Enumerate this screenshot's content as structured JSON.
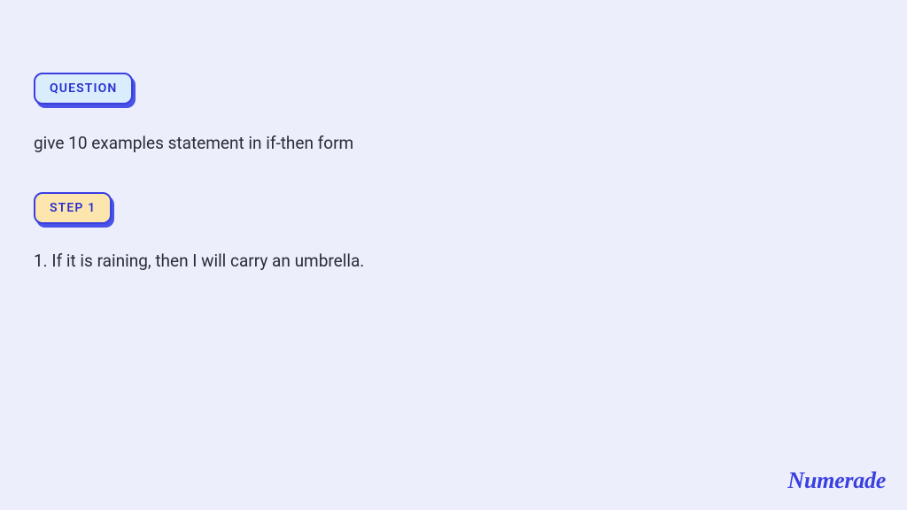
{
  "badges": {
    "question_label": "QUESTION",
    "step_label": "STEP 1"
  },
  "question_text": "give 10 examples statement in if-then form",
  "step_text": "1. If it is raining, then I will carry an umbrella.",
  "brand": "Numerade",
  "colors": {
    "background": "#eceefb",
    "badge_border": "#3a3fe0",
    "badge_shadow": "#4a53e8",
    "question_badge_bg": "#d9edfc",
    "step_badge_bg": "#fde6ad",
    "text": "#2a2c3a",
    "brand": "#3a3fe0"
  }
}
